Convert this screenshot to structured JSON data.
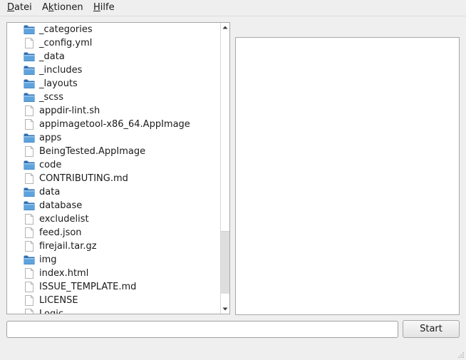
{
  "menubar": {
    "items": [
      {
        "label": "Datei",
        "mnemonic": "D",
        "rest": "atei"
      },
      {
        "label": "Aktionen",
        "pre": "A",
        "mnemonic": "k",
        "rest": "tionen"
      },
      {
        "label": "Hilfe",
        "mnemonic": "H",
        "rest": "ilfe"
      }
    ]
  },
  "files": [
    {
      "name": "_categories",
      "type": "folder"
    },
    {
      "name": "_config.yml",
      "type": "file"
    },
    {
      "name": "_data",
      "type": "folder"
    },
    {
      "name": "_includes",
      "type": "folder"
    },
    {
      "name": "_layouts",
      "type": "folder"
    },
    {
      "name": "_scss",
      "type": "folder"
    },
    {
      "name": "appdir-lint.sh",
      "type": "file"
    },
    {
      "name": "appimagetool-x86_64.AppImage",
      "type": "file"
    },
    {
      "name": "apps",
      "type": "folder"
    },
    {
      "name": "BeingTested.AppImage",
      "type": "file"
    },
    {
      "name": "code",
      "type": "folder"
    },
    {
      "name": "CONTRIBUTING.md",
      "type": "file"
    },
    {
      "name": "data",
      "type": "folder"
    },
    {
      "name": "database",
      "type": "folder"
    },
    {
      "name": "excludelist",
      "type": "file"
    },
    {
      "name": "feed.json",
      "type": "file"
    },
    {
      "name": "firejail.tar.gz",
      "type": "file"
    },
    {
      "name": "img",
      "type": "folder"
    },
    {
      "name": "index.html",
      "type": "file"
    },
    {
      "name": "ISSUE_TEMPLATE.md",
      "type": "file"
    },
    {
      "name": "LICENSE",
      "type": "file"
    },
    {
      "name": "Logic",
      "type": "file"
    }
  ],
  "command": {
    "value": "",
    "placeholder": ""
  },
  "start_button": {
    "label": "Start"
  },
  "icons": {
    "folder": "folder-icon",
    "file": "file-icon",
    "scroll_up": "arrow-up-icon",
    "scroll_down": "arrow-down-icon",
    "grip": "resize-grip-icon"
  },
  "colors": {
    "folder_fill": "#5ea3dc",
    "folder_dark": "#2f6fb3",
    "window_bg": "#efefef"
  },
  "scrollbar": {
    "thumb_start_fraction": 0.73,
    "thumb_size_fraction": 0.23
  }
}
